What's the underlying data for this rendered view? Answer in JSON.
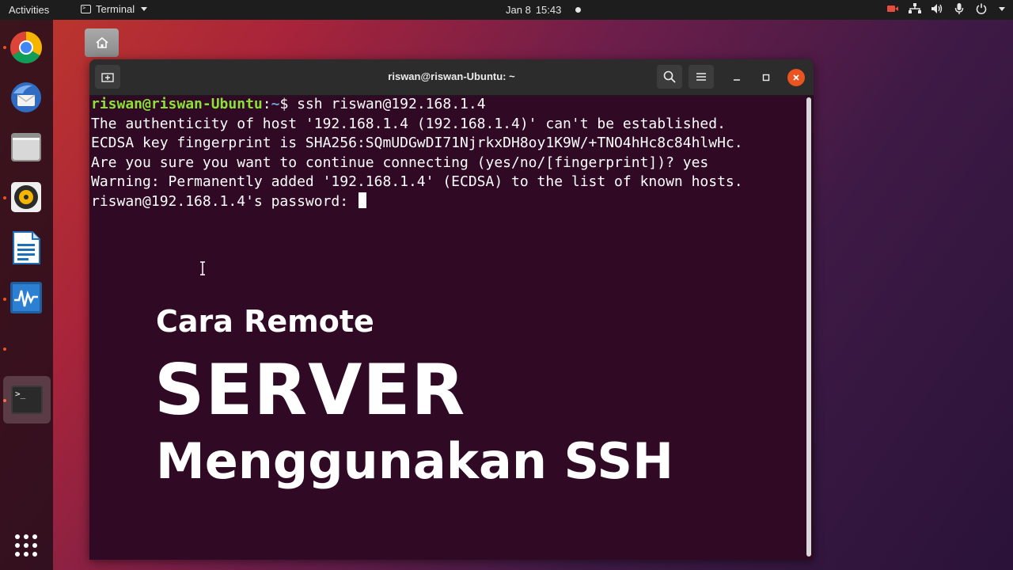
{
  "topbar": {
    "activities": "Activities",
    "app_menu": "Terminal",
    "date": "Jan 8",
    "time": "15:43"
  },
  "dock": {
    "items": [
      "Google Chrome",
      "Thunderbird Mail",
      "Files",
      "Rhythmbox",
      "LibreOffice Writer",
      "System Monitor",
      "Terminal",
      "Show Applications"
    ]
  },
  "window": {
    "title": "riswan@riswan-Ubuntu: ~"
  },
  "terminal": {
    "prompt_user": "riswan@riswan-Ubuntu",
    "prompt_path": "~",
    "prompt_symbol": "$ ",
    "command": "ssh riswan@192.168.1.4",
    "output": [
      "The authenticity of host '192.168.1.4 (192.168.1.4)' can't be established.",
      "ECDSA key fingerprint is SHA256:SQmUDGwDI71NjrkxDH8oy1K9W/+TNO4hHc8c84hlwHc.",
      "Are you sure you want to continue connecting (yes/no/[fingerprint])? yes",
      "Warning: Permanently added '192.168.1.4' (ECDSA) to the list of known hosts."
    ],
    "password_prompt": "riswan@192.168.1.4's password: "
  },
  "overlay": {
    "line1": "Cara Remote",
    "line2": "SERVER",
    "line3": "Menggunakan SSH"
  },
  "colors": {
    "terminal_bg": "#300a24",
    "prompt_user": "#8ae234",
    "prompt_path": "#729fcf",
    "accent": "#e95420"
  }
}
